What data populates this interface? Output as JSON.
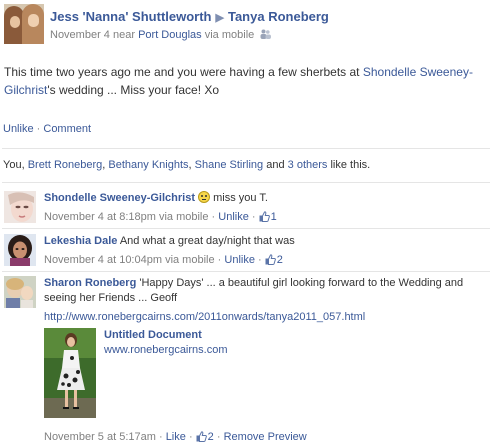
{
  "header": {
    "author": "Jess 'Nanna' Shuttleworth",
    "recipient": "Tanya Roneberg",
    "date": "November 4",
    "near_label": "near",
    "location": "Port Douglas",
    "via": "via mobile"
  },
  "post": {
    "text_before": "This time two years ago me and you were having a few sherbets at ",
    "tagged": "Shondelle Sweeney-Gilchrist",
    "text_after": "'s wedding ... Miss your face! Xo"
  },
  "actions": {
    "unlike": "Unlike",
    "comment": "Comment",
    "sep": "·"
  },
  "likes": {
    "you": "You",
    "p1": "Brett Roneberg",
    "p2": "Bethany Knights",
    "p3": "Shane Stirling",
    "and": "and",
    "others": "3 others",
    "like_this": "like this."
  },
  "comments": [
    {
      "author": "Shondelle Sweeney-Gilchrist",
      "text": "miss you T.",
      "time": "November 4 at 8:18pm via mobile",
      "unlike": "Unlike",
      "likes": "1"
    },
    {
      "author": "Lekeshia Dale",
      "text": "And what a great day/night that was",
      "time": "November 4 at 10:04pm via mobile",
      "unlike": "Unlike",
      "likes": "2"
    },
    {
      "author": "Sharon Roneberg",
      "text": "'Happy Days' ... a beautiful girl looking forward to the Wedding and seeing her Friends ... Geoff",
      "url": "http://www.ronebergcairns.com/2011onwards/tanya2011_057.html",
      "preview_title": "Untitled Document",
      "preview_domain": "www.ronebergcairns.com",
      "time": "November 5 at 5:17am",
      "like": "Like",
      "likes": "2",
      "remove_preview": "Remove Preview"
    }
  ],
  "colors": {
    "link": "#3b5998",
    "meta": "#808080",
    "text": "#333333"
  },
  "icons": [
    "friends-audience-icon",
    "thumbs-up-icon",
    "smiley-emoticon-icon"
  ]
}
